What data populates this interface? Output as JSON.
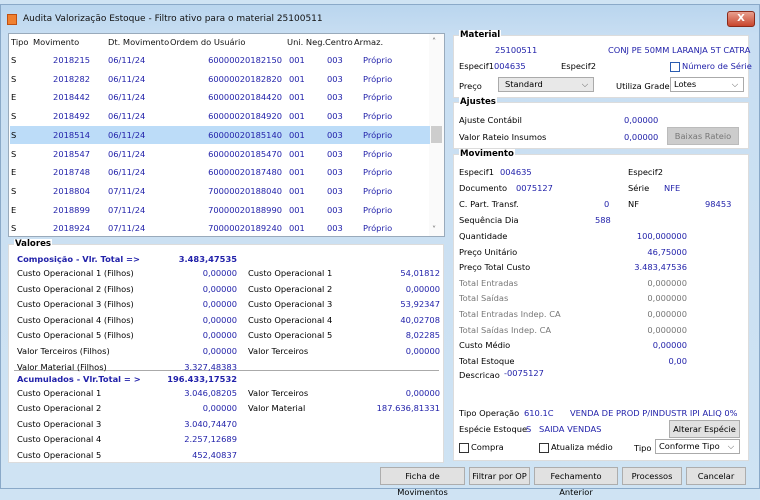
{
  "window": {
    "title": "Audita Valorização Estoque - Filtro ativo para o material 25100511",
    "close_label": "X"
  },
  "list": {
    "columns": [
      "Tipo",
      "Movimento",
      "Dt. Movimento",
      "Ordem do Usuário",
      "Uni. Neg.",
      "Centro",
      "Armaz."
    ],
    "selected_index": 4,
    "rows": [
      [
        "S",
        "2018215",
        "06/11/24",
        "60000020182150",
        "001",
        "003",
        "Próprio"
      ],
      [
        "S",
        "2018282",
        "06/11/24",
        "60000020182820",
        "001",
        "003",
        "Próprio"
      ],
      [
        "E",
        "2018442",
        "06/11/24",
        "60000020184420",
        "001",
        "003",
        "Próprio"
      ],
      [
        "S",
        "2018492",
        "06/11/24",
        "60000020184920",
        "001",
        "003",
        "Próprio"
      ],
      [
        "S",
        "2018514",
        "06/11/24",
        "60000020185140",
        "001",
        "003",
        "Próprio"
      ],
      [
        "S",
        "2018547",
        "06/11/24",
        "60000020185470",
        "001",
        "003",
        "Próprio"
      ],
      [
        "E",
        "2018748",
        "06/11/24",
        "60000020187480",
        "001",
        "003",
        "Próprio"
      ],
      [
        "S",
        "2018804",
        "07/11/24",
        "70000020188040",
        "001",
        "003",
        "Próprio"
      ],
      [
        "E",
        "2018899",
        "07/11/24",
        "70000020188990",
        "001",
        "003",
        "Próprio"
      ],
      [
        "S",
        "2018924",
        "07/11/24",
        "70000020189240",
        "001",
        "003",
        "Próprio"
      ]
    ]
  },
  "valores": {
    "title": "Valores",
    "composicao": {
      "label": "Composição - Vlr. Total =>",
      "value": "3.483,47535",
      "left": [
        [
          "Custo Operacional 1 (Filhos)",
          "0,00000"
        ],
        [
          "Custo Operacional 2 (Filhos)",
          "0,00000"
        ],
        [
          "Custo Operacional 3 (Filhos)",
          "0,00000"
        ],
        [
          "Custo Operacional 4 (Filhos)",
          "0,00000"
        ],
        [
          "Custo Operacional 5 (Filhos)",
          "0,00000"
        ],
        [
          "Valor Terceiros (Filhos)",
          "0,00000"
        ],
        [
          "Valor Material (Filhos)",
          "3.327,48383"
        ]
      ],
      "right": [
        [
          "Custo Operacional 1",
          "54,01812"
        ],
        [
          "Custo Operacional 2",
          "0,00000"
        ],
        [
          "Custo Operacional 3",
          "53,92347"
        ],
        [
          "Custo Operacional 4",
          "40,02708"
        ],
        [
          "Custo Operacional 5",
          "8,02285"
        ],
        [
          "Valor Terceiros",
          "0,00000"
        ]
      ]
    },
    "acumulados": {
      "label": "Acumulados - Vlr.Total = >",
      "value": "196.433,17532",
      "left": [
        [
          "Custo Operacional 1",
          "3.046,08205"
        ],
        [
          "Custo Operacional 2",
          "0,00000"
        ],
        [
          "Custo Operacional 3",
          "3.040,74470"
        ],
        [
          "Custo Operacional 4",
          "2.257,12689"
        ],
        [
          "Custo Operacional 5",
          "452,40837"
        ]
      ],
      "right": [
        [
          "Valor Terceiros",
          "0,00000"
        ],
        [
          "Valor Material",
          "187.636,81331"
        ]
      ]
    }
  },
  "material": {
    "title": "Material",
    "code": "25100511",
    "description": "CONJ PE 50MM LARANJA 5T CATRA",
    "especif1_label": "Especif1",
    "especif1": "004635",
    "especif2_label": "Especif2",
    "numero_serie_label": "Número de Série",
    "numero_serie_checked": false,
    "preco_label": "Preço",
    "preco": "Standard",
    "grade_label": "Utiliza Grade",
    "grade": "Lotes"
  },
  "ajustes": {
    "title": "Ajustes",
    "contabil_label": "Ajuste Contábil",
    "contabil": "0,00000",
    "rateio_label": "Valor Rateio Insumos",
    "rateio": "0,00000",
    "baixas_button": "Baixas Rateio"
  },
  "movimento": {
    "title": "Movimento",
    "especif1_label": "Especif1",
    "especif1": "004635",
    "especif2_label": "Especif2",
    "documento_label": "Documento",
    "documento": "0075127",
    "serie_label": "Série",
    "serie": "NFE",
    "cpart_label": "C. Part. Transf.",
    "cpart": "0",
    "nf_label": "NF",
    "nf": "98453",
    "seq_label": "Sequência Dia",
    "seq": "588",
    "values": [
      [
        "Quantidade",
        "100,000000",
        false
      ],
      [
        "Preço Unitário",
        "46,75000",
        false
      ],
      [
        "Preço Total Custo",
        "3.483,47536",
        false
      ],
      [
        "Total Entradas",
        "0,000000",
        true
      ],
      [
        "Total Saídas",
        "0,000000",
        true
      ],
      [
        "Total Entradas Indep. CA",
        "0,000000",
        true
      ],
      [
        "Total Saídas Indep. CA",
        "0,000000",
        true
      ],
      [
        "Custo Médio",
        "0,00000",
        false
      ],
      [
        "Total Estoque",
        "0,00",
        false
      ]
    ],
    "descricao_label": "Descricao",
    "descricao": "-0075127",
    "tipo_op_label": "Tipo Operação",
    "tipo_op_code": "610.1C",
    "tipo_op_desc": "VENDA DE PROD P/INDUSTR IPI ALIQ 0%",
    "especie_label": "Espécie Estoque",
    "especie_code": "S",
    "especie_desc": "SAIDA VENDAS",
    "alterar_button": "Alterar Espécie",
    "compra_label": "Compra",
    "compra_checked": false,
    "atualiza_label": "Atualiza médio",
    "atualiza_checked": false,
    "tipo_label": "Tipo",
    "tipo": "Conforme Tipo"
  },
  "buttons": {
    "ficha": "Ficha de Movimentos",
    "filtrar": "Filtrar por OP",
    "fechamento": "Fechamento Anterior",
    "processos": "Processos",
    "cancelar": "Cancelar"
  },
  "colors": {
    "accent_text": "#2222aa",
    "selection": "#bcdcf8"
  }
}
